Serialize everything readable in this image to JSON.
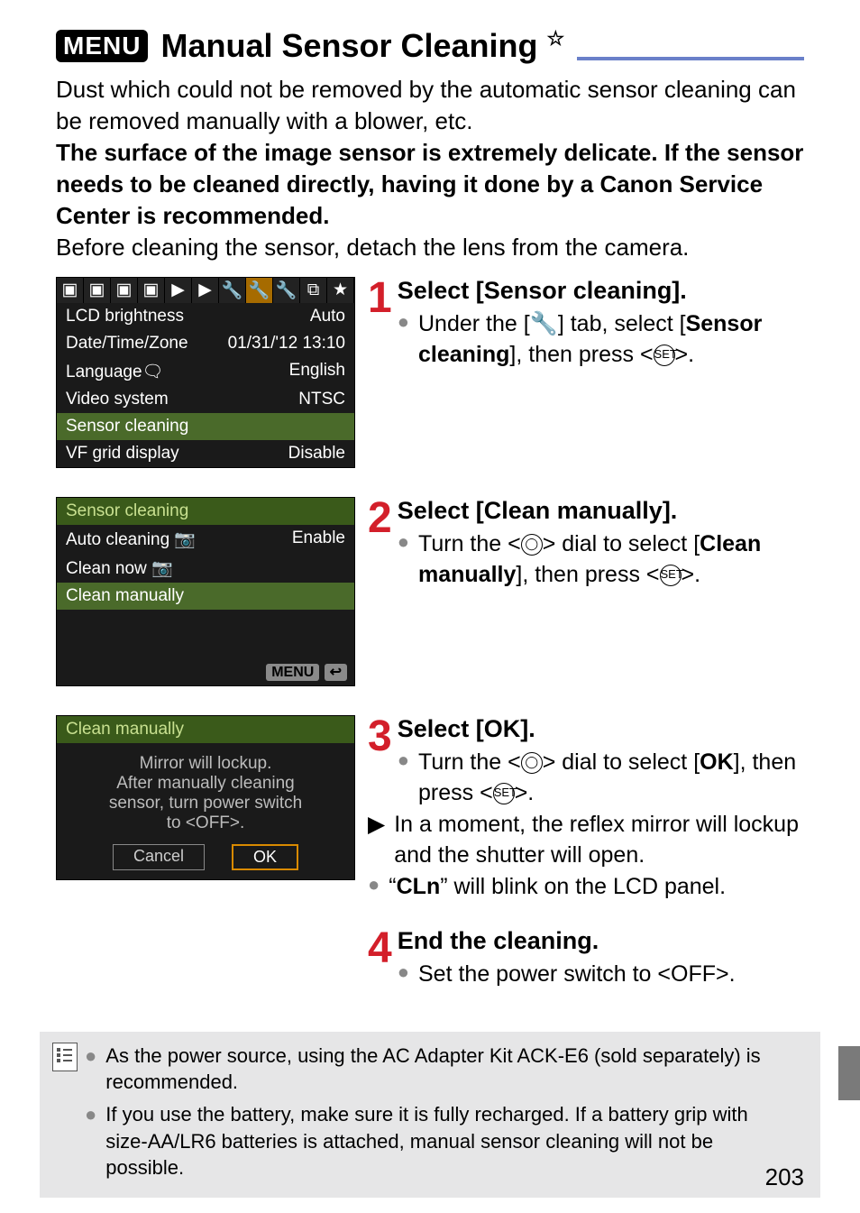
{
  "header": {
    "menu_badge": "MENU",
    "title": "Manual Sensor Cleaning",
    "star": "☆"
  },
  "intro": {
    "p1": "Dust which could not be removed by the automatic sensor cleaning can be removed manually with a blower, etc.",
    "p2_bold": "The surface of the image sensor is extremely delicate. If the sensor needs to be cleaned directly, having it done by a Canon Service Center is recommended.",
    "p3": "Before cleaning the sensor, detach the lens from the camera."
  },
  "screens": {
    "s1": {
      "rows": [
        {
          "l": "LCD brightness",
          "r": "Auto"
        },
        {
          "l": "Date/Time/Zone",
          "r": "01/31/'12 13:10"
        },
        {
          "l": "Language",
          "r": "English"
        },
        {
          "l": "Video system",
          "r": "NTSC"
        },
        {
          "l": "Sensor cleaning",
          "r": ""
        },
        {
          "l": "VF grid display",
          "r": "Disable"
        }
      ]
    },
    "s2": {
      "title": "Sensor cleaning",
      "rows": [
        {
          "l": "Auto cleaning",
          "r": "Enable"
        },
        {
          "l": "Clean now",
          "r": ""
        },
        {
          "l": "Clean manually",
          "r": ""
        }
      ],
      "back": "MENU"
    },
    "s3": {
      "title": "Clean manually",
      "lines": [
        "Mirror will lockup.",
        "After manually cleaning",
        "sensor, turn power switch",
        "to <OFF>."
      ],
      "cancel": "Cancel",
      "ok": "OK"
    }
  },
  "steps": {
    "s1": {
      "num": "1",
      "title": "Select [Sensor cleaning].",
      "b1a": "Under the [",
      "b1b": "] tab, select [",
      "b1c": "Sensor cleaning",
      "b1d": "], then press <",
      "b1e": ">."
    },
    "s2": {
      "num": "2",
      "title": "Select [Clean manually].",
      "b1a": "Turn the <",
      "b1b": "> dial to select [",
      "b1c": "Clean manually",
      "b1d": "], then press <",
      "b1e": ">."
    },
    "s3": {
      "num": "3",
      "title": "Select [OK].",
      "b1a": "Turn the <",
      "b1b": "> dial to select [",
      "b1c": "OK",
      "b1d": "], then press <",
      "b1e": ">.",
      "b2": "In a moment, the reflex mirror will lockup and the shutter will open.",
      "b3a": "“",
      "b3b": "CLn",
      "b3c": "” will blink on the LCD panel."
    },
    "s4": {
      "num": "4",
      "title": "End the cleaning.",
      "b1a": "Set the power switch to <",
      "b1b": "OFF",
      "b1c": ">."
    }
  },
  "notes": {
    "n1": "As the power source, using the AC Adapter Kit ACK-E6 (sold separately) is recommended.",
    "n2": "If you use the battery, make sure it is fully recharged. If a battery grip with size-AA/LR6 batteries is attached, manual sensor cleaning will not be possible."
  },
  "page_number": "203",
  "icons": {
    "wrench": "🔧",
    "speech": "🗨",
    "set": "SET",
    "dial": "◯",
    "lang_globe": "☄",
    "sensor": "📷"
  }
}
